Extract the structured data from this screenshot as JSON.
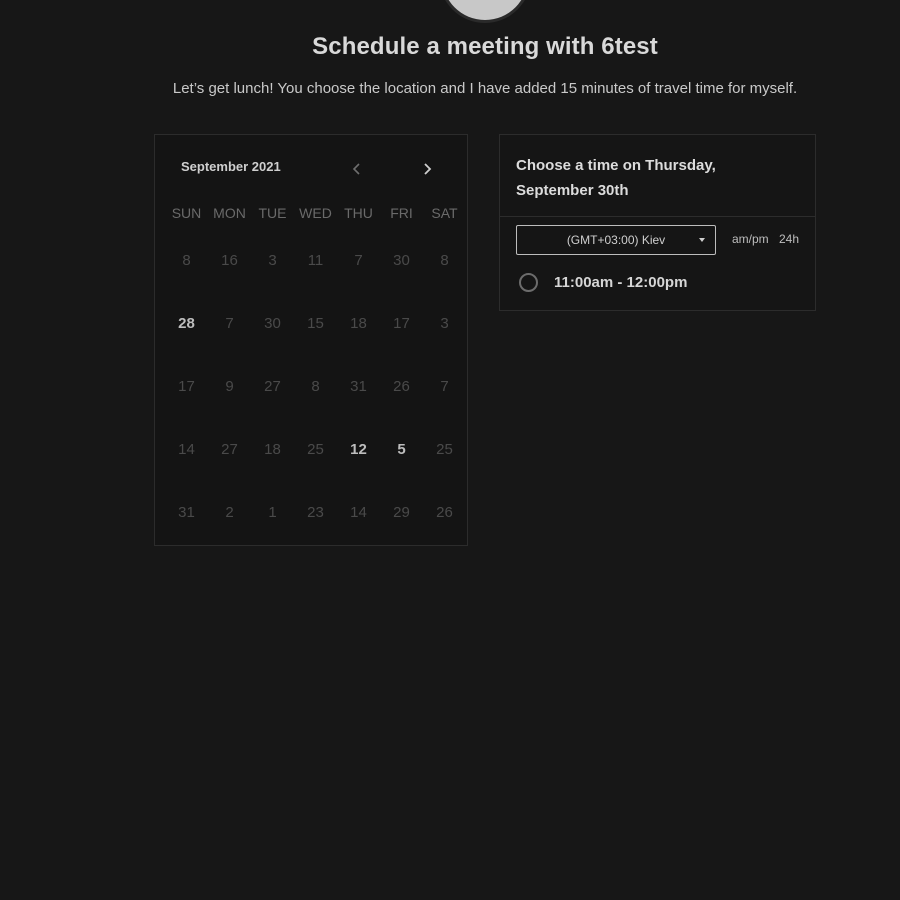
{
  "header": {
    "title": "Schedule a meeting with 6test",
    "description": "Let’s get lunch! You choose the location and I have added 15 minutes of travel time for myself."
  },
  "calendar": {
    "month_label": "September 2021",
    "prev_icon": "chevron-left-icon",
    "next_icon": "chevron-right-icon",
    "weekdays": [
      "SUN",
      "MON",
      "TUE",
      "WED",
      "THU",
      "FRI",
      "SAT"
    ],
    "days": [
      {
        "label": "8",
        "available": false
      },
      {
        "label": "16",
        "available": false
      },
      {
        "label": "3",
        "available": false
      },
      {
        "label": "11",
        "available": false
      },
      {
        "label": "7",
        "available": false
      },
      {
        "label": "30",
        "available": false
      },
      {
        "label": "8",
        "available": false
      },
      {
        "label": "28",
        "available": true
      },
      {
        "label": "7",
        "available": false
      },
      {
        "label": "30",
        "available": false
      },
      {
        "label": "15",
        "available": false
      },
      {
        "label": "18",
        "available": false
      },
      {
        "label": "17",
        "available": false
      },
      {
        "label": "3",
        "available": false
      },
      {
        "label": "17",
        "available": false
      },
      {
        "label": "9",
        "available": false
      },
      {
        "label": "27",
        "available": false
      },
      {
        "label": "8",
        "available": false
      },
      {
        "label": "31",
        "available": false
      },
      {
        "label": "26",
        "available": false
      },
      {
        "label": "7",
        "available": false
      },
      {
        "label": "14",
        "available": false
      },
      {
        "label": "27",
        "available": false
      },
      {
        "label": "18",
        "available": false
      },
      {
        "label": "25",
        "available": false
      },
      {
        "label": "12",
        "available": true
      },
      {
        "label": "5",
        "available": true
      },
      {
        "label": "25",
        "available": false
      },
      {
        "label": "31",
        "available": false
      },
      {
        "label": "2",
        "available": false
      },
      {
        "label": "1",
        "available": false
      },
      {
        "label": "23",
        "available": false
      },
      {
        "label": "14",
        "available": false
      },
      {
        "label": "29",
        "available": false
      },
      {
        "label": "26",
        "available": false
      }
    ]
  },
  "time_panel": {
    "title": "Choose a time on Thursday, September 30th",
    "timezone_value": "(GMT+03:00) Kiev",
    "format_ampm": "am/pm",
    "format_24h": "24h",
    "slots": [
      {
        "label": "11:00am - 12:00pm"
      }
    ]
  },
  "colors": {
    "background": "#171717",
    "panel": "#141414",
    "text_primary": "#d9d9d9",
    "text_disabled": "#4a4a4a"
  }
}
